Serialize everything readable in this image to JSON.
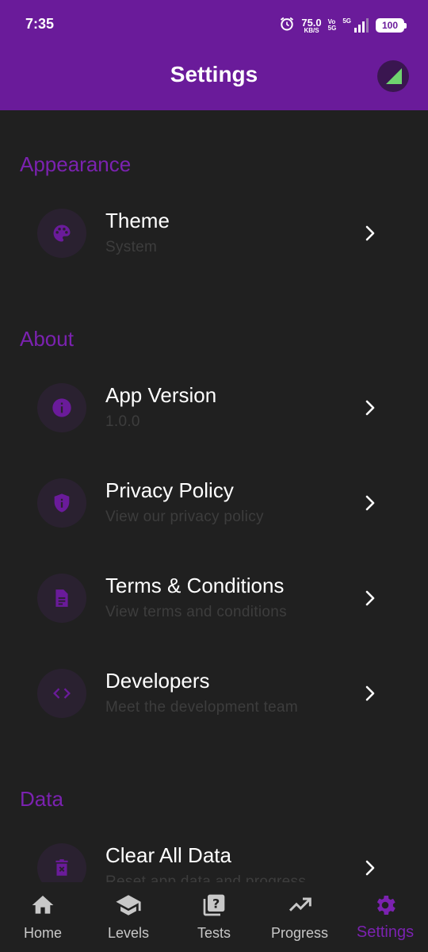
{
  "status_bar": {
    "time": "7:35",
    "speed_value": "75.0",
    "speed_unit": "KB/S",
    "volte_top": "Vo",
    "volte_bottom": "5G",
    "network": "5G",
    "battery": "100"
  },
  "header": {
    "title": "Settings"
  },
  "sections": {
    "appearance": {
      "title": "Appearance"
    },
    "about": {
      "title": "About"
    },
    "data": {
      "title": "Data"
    }
  },
  "items": {
    "theme": {
      "title": "Theme",
      "subtitle": "System",
      "icon": "palette-icon"
    },
    "app_version": {
      "title": "App Version",
      "subtitle": "1.0.0",
      "icon": "info-icon"
    },
    "privacy": {
      "title": "Privacy Policy",
      "subtitle": "View our privacy policy",
      "icon": "shield-icon"
    },
    "terms": {
      "title": "Terms & Conditions",
      "subtitle": "View terms and conditions",
      "icon": "document-icon"
    },
    "developers": {
      "title": "Developers",
      "subtitle": "Meet the development team",
      "icon": "code-icon"
    },
    "clear_data": {
      "title": "Clear All Data",
      "subtitle": "Reset app data and progress",
      "icon": "delete-icon"
    }
  },
  "bottom_nav": {
    "items": [
      {
        "label": "Home",
        "icon": "home-icon"
      },
      {
        "label": "Levels",
        "icon": "school-icon"
      },
      {
        "label": "Tests",
        "icon": "quiz-icon"
      },
      {
        "label": "Progress",
        "icon": "trending-up-icon"
      },
      {
        "label": "Settings",
        "icon": "gear-icon"
      }
    ],
    "active": "Settings"
  },
  "colors": {
    "primary": "#6a1b9a",
    "accent": "#7b22b0",
    "background": "#202020",
    "icon_circle": "#2a2130",
    "subtitle": "#3d3d3d",
    "nav_label": "#c8c8c8"
  }
}
